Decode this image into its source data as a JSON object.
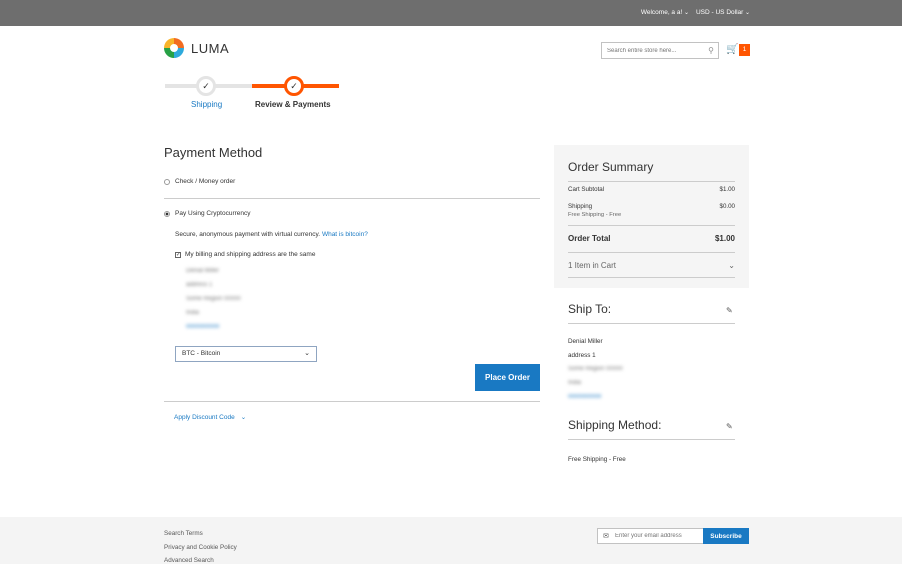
{
  "header": {
    "welcome": "Welcome, a a!",
    "currency": "USD - US Dollar",
    "logo_text": "LUMA",
    "search_placeholder": "Search entire store here...",
    "cart_count": "1"
  },
  "progress": {
    "steps": [
      {
        "label": "Shipping",
        "state": "complete"
      },
      {
        "label": "Review & Payments",
        "state": "active"
      }
    ]
  },
  "payment": {
    "title": "Payment Method",
    "option_check": "Check / Money order",
    "option_crypto": "Pay Using Cryptocurrency",
    "crypto_desc": "Secure, anonymous payment with virtual currency.",
    "crypto_link": "What is bitcoin?",
    "same_address_label": "My billing and shipping address are the same",
    "address_blurred": [
      "Denial Miller",
      "address 1",
      "Some Region 00000",
      "India",
      "0000000000"
    ],
    "currency_select": "BTC - Bitcoin",
    "place_order": "Place Order",
    "discount_label": "Apply Discount Code"
  },
  "summary": {
    "title": "Order Summary",
    "subtotal_label": "Cart Subtotal",
    "subtotal_value": "$1.00",
    "shipping_label": "Shipping",
    "shipping_value": "$0.00",
    "shipping_sub": "Free Shipping - Free",
    "total_label": "Order Total",
    "total_value": "$1.00",
    "items_in_cart": "1 Item in Cart"
  },
  "ship_to": {
    "title": "Ship To:",
    "name": "Denial Miller",
    "address1": "address 1",
    "blurred": [
      "Some Region 00000",
      "India",
      "0000000000"
    ]
  },
  "shipping_method": {
    "title": "Shipping Method:",
    "value": "Free Shipping - Free"
  },
  "footer": {
    "links": [
      "Search Terms",
      "Privacy and Cookie Policy",
      "Advanced Search"
    ],
    "email_placeholder": "Enter your email address",
    "subscribe": "Subscribe"
  },
  "colors": {
    "accent_blue": "#1979c3",
    "accent_orange": "#ff5501",
    "topbar": "#6e6e6e"
  }
}
